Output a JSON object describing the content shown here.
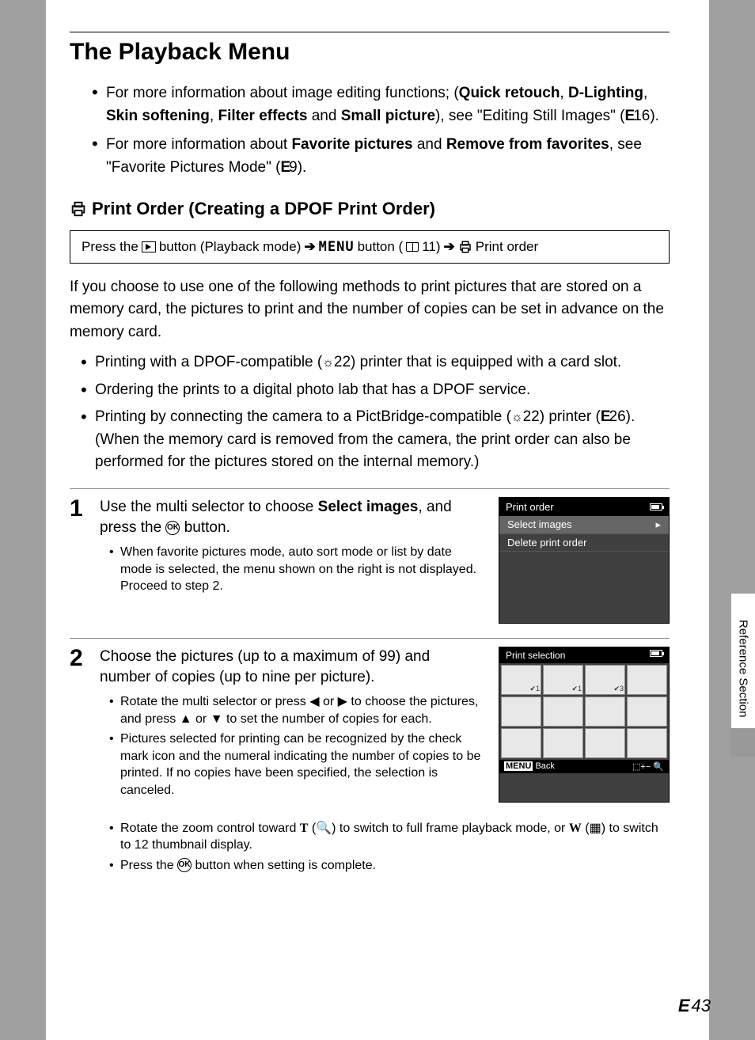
{
  "page": {
    "title": "The Playback Menu",
    "sideTab": "Reference Section",
    "pageNumber": "43"
  },
  "intro": {
    "bullet1_pre": "For more information about image editing functions; (",
    "bullet1_b1": "Quick retouch",
    "bullet1_s1": ", ",
    "bullet1_b2": "D-Lighting",
    "bullet1_s2": ", ",
    "bullet1_b3": "Skin softening",
    "bullet1_s3": ", ",
    "bullet1_b4": "Filter effects",
    "bullet1_s4": " and ",
    "bullet1_b5": "Small picture",
    "bullet1_post": "), see \"Editing Still Images\" (",
    "bullet1_ref": "16).",
    "bullet2_pre": "For more information about ",
    "bullet2_b1": "Favorite pictures",
    "bullet2_mid": " and ",
    "bullet2_b2": "Remove from favorites",
    "bullet2_post": ", see \"Favorite Pictures Mode\" (",
    "bullet2_ref": "9)."
  },
  "printOrder": {
    "heading": " Print Order (Creating a DPOF Print Order)",
    "nav_p1": "Press the ",
    "nav_p2": " button (Playback mode) ",
    "nav_menu": "MENU",
    "nav_p3": " button (",
    "nav_p4": "11) ",
    "nav_p5": " Print order",
    "body": "If you choose to use one of the following methods to print pictures that are stored on a memory card, the pictures to print and the number of copies can be set in advance on the memory card.",
    "m1_pre": "Printing with a DPOF-compatible (",
    "m1_ref": "22) printer that is equipped with a card slot.",
    "m2": "Ordering the prints to a digital photo lab that has a DPOF service.",
    "m3_pre": "Printing by connecting the camera to a PictBridge-compatible (",
    "m3_ref1": "22) printer (",
    "m3_ref2": "26). (When the memory card is removed from the camera, the print order can also be performed for the pictures stored on the internal memory.)"
  },
  "step1": {
    "num": "1",
    "title_pre": "Use the multi selector to choose ",
    "title_b": "Select images",
    "title_mid": ", and press the ",
    "ok": "OK",
    "title_post": " button.",
    "sub": "When favorite pictures mode, auto sort mode or list by date mode is selected, the menu shown on the right is not displayed. Proceed to step 2.",
    "screen": {
      "header": "Print order",
      "item1": "Select images",
      "item2": "Delete print order"
    }
  },
  "step2": {
    "num": "2",
    "title": "Choose the pictures (up to a maximum of 99) and number of copies (up to nine per picture).",
    "sub1_pre": "Rotate the multi selector or press ",
    "sub1_mid": " or ",
    "sub1_mid2": " to choose the pictures, and press ",
    "sub1_mid3": " or ",
    "sub1_post": " to set the number of copies for each.",
    "sub2": "Pictures selected for printing can be recognized by the check mark icon and the numeral indicating the number of copies to be printed. If no copies have been specified, the selection is canceled.",
    "sub3_pre": "Rotate the zoom control toward ",
    "sub3_T": "T",
    "sub3_mid1": " (",
    "sub3_mid2": ") to switch to full frame playback mode, or ",
    "sub3_W": "W",
    "sub3_mid3": " (",
    "sub3_post": ") to switch to 12 thumbnail display.",
    "sub4_pre": "Press the ",
    "sub4_post": " button when setting is complete.",
    "screen": {
      "header": "Print selection",
      "footer_back": "Back",
      "footer_menu": "MENU"
    }
  }
}
